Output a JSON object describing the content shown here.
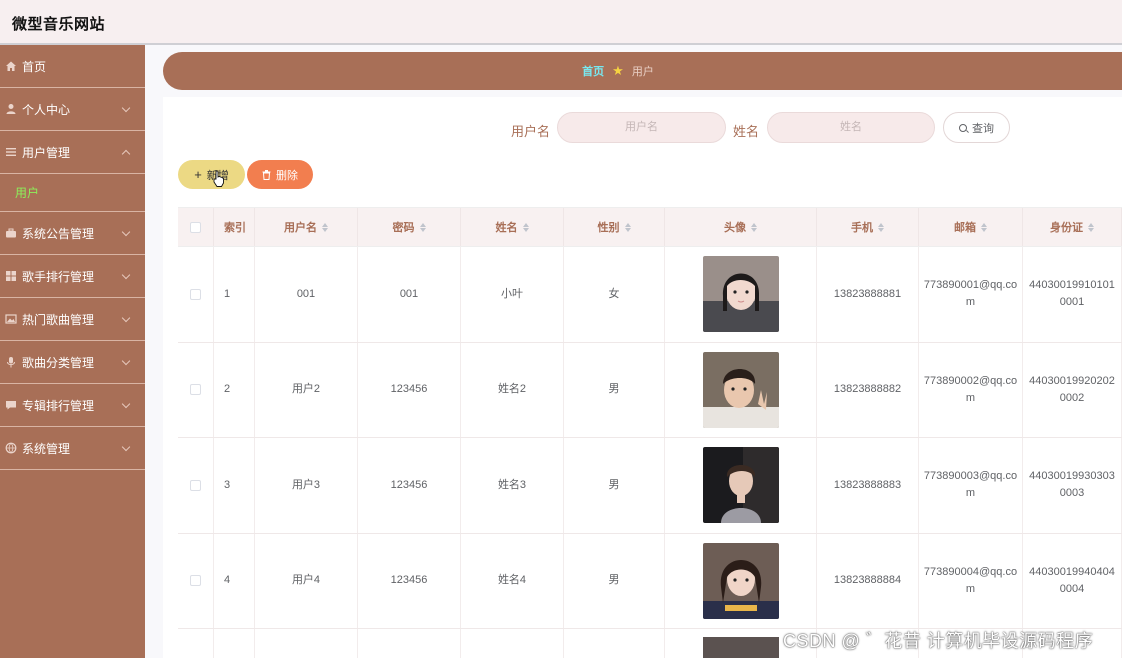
{
  "header": {
    "app_title": "微型音乐网站"
  },
  "sidebar": {
    "items": [
      {
        "label": "首页",
        "icon": "home-icon",
        "has_chevron": false
      },
      {
        "label": "个人中心",
        "icon": "person-icon",
        "has_chevron": true
      },
      {
        "label": "用户管理",
        "icon": "list-icon",
        "has_chevron": true,
        "expanded": true
      },
      {
        "label": "系统公告管理",
        "icon": "briefcase-icon",
        "has_chevron": true
      },
      {
        "label": "歌手排行管理",
        "icon": "grid-icon",
        "has_chevron": true
      },
      {
        "label": "热门歌曲管理",
        "icon": "picture-icon",
        "has_chevron": true
      },
      {
        "label": "歌曲分类管理",
        "icon": "microphone-icon",
        "has_chevron": true
      },
      {
        "label": "专辑排行管理",
        "icon": "chat-icon",
        "has_chevron": true
      },
      {
        "label": "系统管理",
        "icon": "globe-icon",
        "has_chevron": true
      }
    ],
    "submenu": {
      "label": "用户"
    },
    "active_color": "#8cf05a"
  },
  "breadcrumb": {
    "home": "首页",
    "current": "用户"
  },
  "search": {
    "username_label": "用户名",
    "username_placeholder": "用户名",
    "name_label": "姓名",
    "name_placeholder": "姓名",
    "query_button": "查询"
  },
  "actions": {
    "add_label": "新增",
    "delete_label": "删除"
  },
  "table": {
    "headers": [
      "索引",
      "用户名",
      "密码",
      "姓名",
      "性别",
      "头像",
      "手机",
      "邮箱",
      "身份证"
    ],
    "rows": [
      {
        "index": "1",
        "username": "001",
        "password": "001",
        "name": "小叶",
        "gender": "女",
        "phone": "13823888881",
        "email": "773890001@qq.com",
        "id_card": "440300199101010001"
      },
      {
        "index": "2",
        "username": "用户2",
        "password": "123456",
        "name": "姓名2",
        "gender": "男",
        "phone": "13823888882",
        "email": "773890002@qq.com",
        "id_card": "440300199202020002"
      },
      {
        "index": "3",
        "username": "用户3",
        "password": "123456",
        "name": "姓名3",
        "gender": "男",
        "phone": "13823888883",
        "email": "773890003@qq.com",
        "id_card": "440300199303030003"
      },
      {
        "index": "4",
        "username": "用户4",
        "password": "123456",
        "name": "姓名4",
        "gender": "男",
        "phone": "13823888884",
        "email": "773890004@qq.com",
        "id_card": "440300199404040004"
      }
    ]
  },
  "watermark": "CSDN @ ゛花昔 计算机毕设源码程序",
  "colors": {
    "brand": "#a86f57",
    "add_button": "#ecd984",
    "delete_button": "#f27e4f",
    "breadcrumb_home": "#78e8f0"
  }
}
